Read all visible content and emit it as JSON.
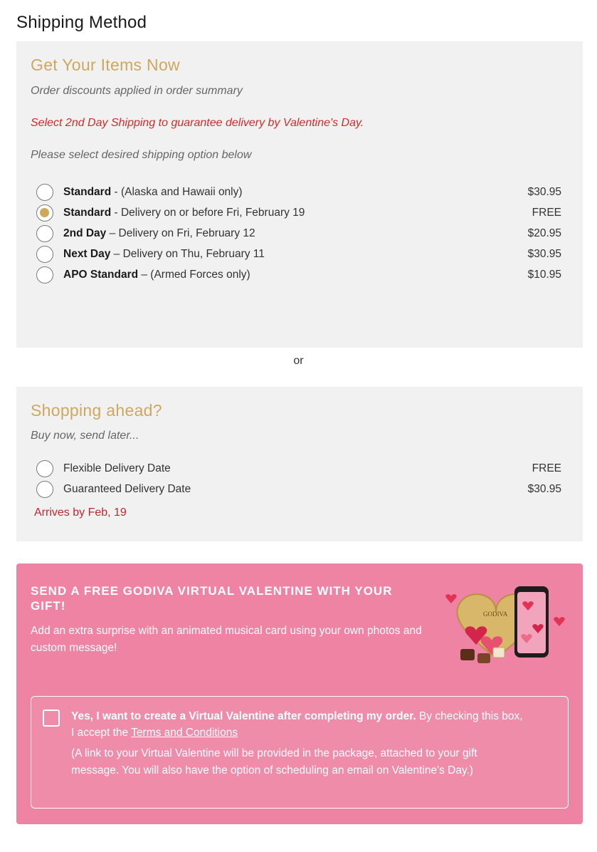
{
  "page": {
    "title": "Shipping Method"
  },
  "get_now": {
    "heading": "Get Your Items Now",
    "discount_note": "Order discounts applied in order summary",
    "promo_note": "Select 2nd Day Shipping to guarantee delivery by Valentine's Day.",
    "instruction": "Please select desired shipping option below",
    "options": [
      {
        "name": "Standard",
        "detail": " - (Alaska and Hawaii only)",
        "price": "$30.95",
        "selected": false
      },
      {
        "name": "Standard",
        "detail": " - Delivery on or before Fri, February 19",
        "price": "FREE",
        "selected": true
      },
      {
        "name": "2nd Day",
        "detail": " – Delivery on Fri, February 12",
        "price": "$20.95",
        "selected": false
      },
      {
        "name": "Next Day",
        "detail": " – Delivery on Thu, February 11",
        "price": "$30.95",
        "selected": false
      },
      {
        "name": "APO Standard",
        "detail": " – (Armed Forces only)",
        "price": "$10.95",
        "selected": false
      }
    ]
  },
  "separator": "or",
  "ahead": {
    "heading": "Shopping ahead?",
    "subheading": "Buy now, send later...",
    "options": [
      {
        "label": "Flexible Delivery Date",
        "price": "FREE",
        "selected": false
      },
      {
        "label": "Guaranteed Delivery Date",
        "price": "$30.95",
        "selected": false
      }
    ],
    "arrives": "Arrives by Feb, 19"
  },
  "promo": {
    "title": "SEND A FREE GODIVA VIRTUAL VALENTINE WITH YOUR GIFT!",
    "description": "Add an extra surprise with an animated musical card using your own photos and custom message!",
    "optin_bold": "Yes, I want to create a Virtual Valentine after completing my order.",
    "optin_rest": " By checking this box, I accept the ",
    "terms_link": "Terms and Conditions",
    "note": "(A link to your Virtual Valentine will be provided in the package, attached to your gift message. You will also have the option of scheduling an email on Valentine's Day.)",
    "checked": false,
    "art_brand": "GODIVA",
    "colors": {
      "background": "#ee83a3",
      "heading_gold": "#cda85d",
      "alert_red": "#d42a2a"
    }
  }
}
